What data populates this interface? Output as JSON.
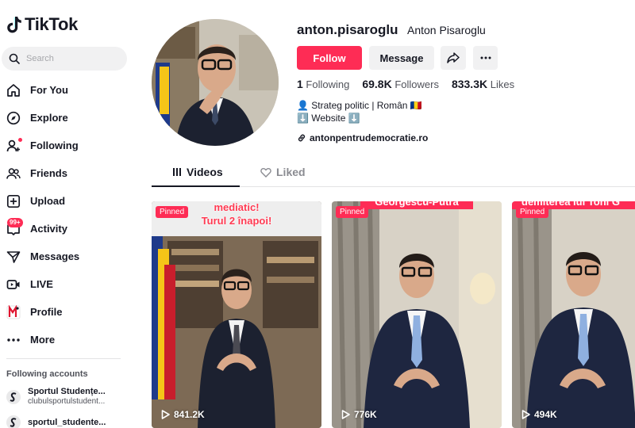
{
  "app": {
    "logo_text": "TikTok"
  },
  "search": {
    "placeholder": "Search"
  },
  "nav": [
    {
      "label": "For You",
      "icon": "home-icon"
    },
    {
      "label": "Explore",
      "icon": "compass-icon"
    },
    {
      "label": "Following",
      "icon": "following-icon"
    },
    {
      "label": "Friends",
      "icon": "friends-icon"
    },
    {
      "label": "Upload",
      "icon": "upload-icon"
    },
    {
      "label": "Activity",
      "icon": "inbox-icon",
      "badge": "99+"
    },
    {
      "label": "Messages",
      "icon": "send-icon"
    },
    {
      "label": "LIVE",
      "icon": "live-icon"
    },
    {
      "label": "Profile",
      "icon": "profile-icon"
    },
    {
      "label": "More",
      "icon": "more-icon"
    }
  ],
  "following_accounts": {
    "title": "Following accounts",
    "items": [
      {
        "name": "Sportul Studențe...",
        "handle": "clubulsportulstudent..."
      },
      {
        "name": "sportul_studente..."
      }
    ]
  },
  "profile": {
    "username": "anton.pisaroglu",
    "nickname": "Anton Pisaroglu",
    "follow_label": "Follow",
    "message_label": "Message",
    "stats": {
      "following_count": "1",
      "following_label": "Following",
      "followers_count": "69.8K",
      "followers_label": "Followers",
      "likes_count": "833.3K",
      "likes_label": "Likes"
    },
    "bio_line1": "👤 Strateg politic | Român 🇷🇴",
    "bio_line2": "⬇️ Website ⬇️",
    "link": "antonpentrudemocratie.ro"
  },
  "tabs": {
    "videos": "Videos",
    "liked": "Liked"
  },
  "videos": [
    {
      "pinned": "Pinned",
      "views": "841.2K",
      "caption_line1": "mediatic!",
      "caption_line2": "Turul 2 înapoi!"
    },
    {
      "pinned": "Pinned",
      "views": "776K",
      "caption_line1": "Georgescu-Putra"
    },
    {
      "pinned": "Pinned",
      "views": "494K",
      "caption_line1": "demiterea lui Toni G"
    }
  ],
  "colors": {
    "accent": "#fe2c55",
    "text": "#161823",
    "secondary": "#50525a"
  }
}
